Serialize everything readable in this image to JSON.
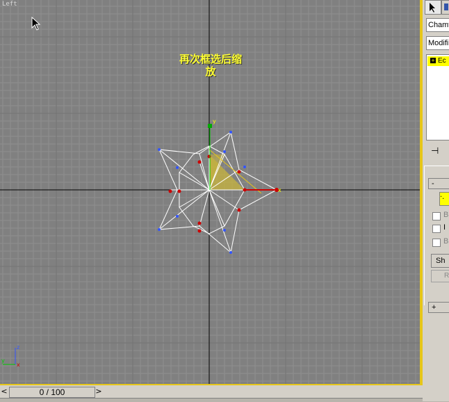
{
  "viewport": {
    "label": "Left",
    "annotation_line1": "再次框选后缩",
    "annotation_line2": "放",
    "axis_x": "x",
    "axis_y": "y",
    "axis_z": "z"
  },
  "timebar": {
    "frame_display": "0 / 100",
    "prev_arrow": "<",
    "next_arrow": ">"
  },
  "command_panel": {
    "object_name": "Chamf",
    "modifier_list": "Modifi",
    "stack_item": "Ec",
    "rollout_minus": "-",
    "rollout_plus": "+",
    "checkbox_labels": [
      "B",
      "I",
      "B"
    ],
    "button_sh": "Sh",
    "button_r": "R",
    "selection_swatch": "·."
  },
  "colors": {
    "viewport_bg": "#808080",
    "active_border": "#e6c619",
    "annotation_text": "#ffff33",
    "vertex_selected": "#cc0000",
    "vertex_unselected": "#3355ff",
    "selected_face": "#c8b43c"
  }
}
